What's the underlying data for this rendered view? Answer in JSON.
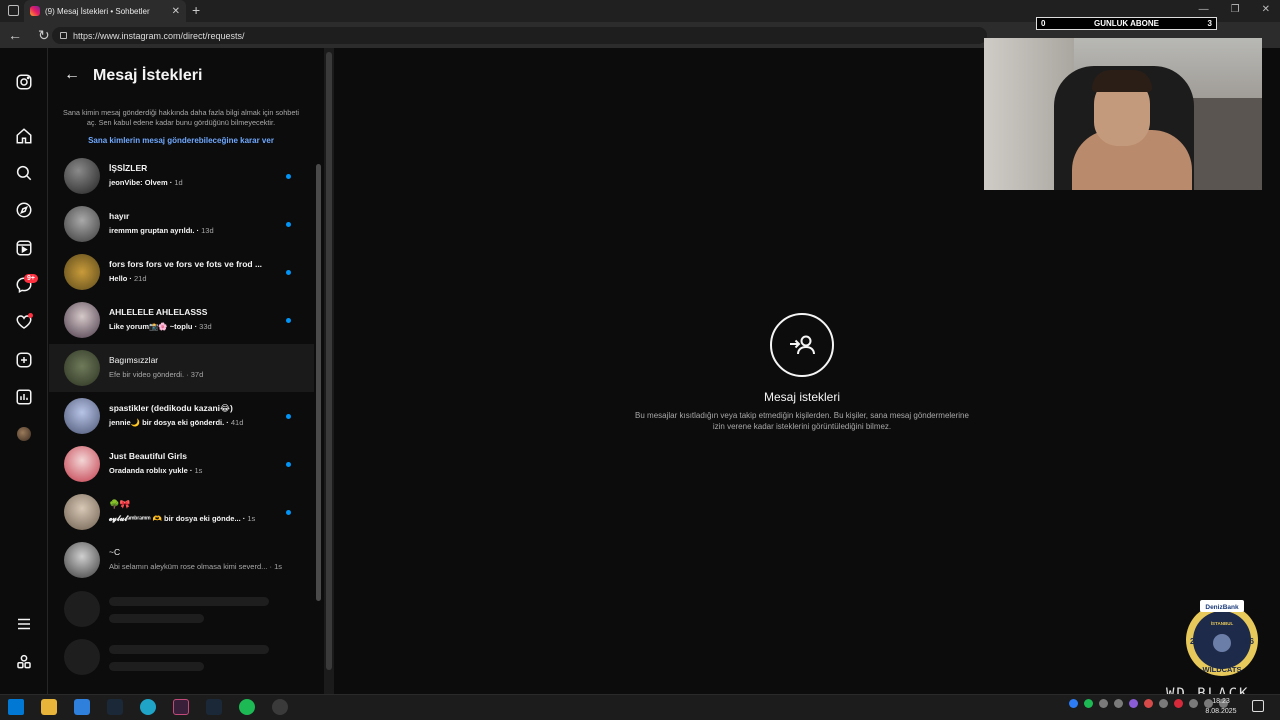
{
  "browser": {
    "tab_title": "(9) Mesaj İstekleri • Sohbetler",
    "tab_close": "✕",
    "new_tab": "+",
    "url": "https://www.instagram.com/direct/requests/",
    "window_controls": [
      "—",
      "❐",
      "✕"
    ]
  },
  "overlay": {
    "left_count": "0",
    "label": "GUNLUK ABONE",
    "right_count": "3"
  },
  "rail": {
    "badge": "9+"
  },
  "panel": {
    "back": "←",
    "title": "Mesaj İstekleri",
    "info": "Sana kimin mesaj gönderdiği hakkında daha fazla bilgi almak için sohbeti aç. Sen kabul edene kadar bunu gördüğünü bilmeyecektir.",
    "link": "Sana kimlerin mesaj gönderebileceğine karar ver",
    "requests": [
      {
        "name": "İŞSİZLER",
        "preview": "jeonVibe: Olvem",
        "time": "1d",
        "unread": true
      },
      {
        "name": "hayır",
        "preview": "iremmm gruptan ayrıldı.",
        "time": "13d",
        "unread": true
      },
      {
        "name": "fors fors fors ve fors ve fots ve frod ...",
        "preview": "Hello",
        "time": "21d",
        "unread": true
      },
      {
        "name": "AHLELELE AHLELASSS",
        "preview": "Like yorum📸🌸 ~toplu",
        "time": "33d",
        "unread": true
      },
      {
        "name": "Bagımsızzlar",
        "preview": "Efe bir video gönderdi.",
        "time": "37d",
        "unread": false
      },
      {
        "name": "spastikler (dedikodu kazani😂)",
        "preview": "jennie🌙 bir dosya eki gönderdi.",
        "time": "41d",
        "unread": true
      },
      {
        "name": "Just Beautiful Girls",
        "preview": "Oradanda roblıx yukle",
        "time": "1s",
        "unread": true
      },
      {
        "name": "🌳🎀",
        "preview": "𝓮𝔂𝓵𝓾𝓵ᵃᵐᵇʳᵃᵐᵐ 🫶 bir dosya eki gönde...",
        "time": "1s",
        "unread": true
      },
      {
        "name": "~C",
        "preview": "Abi selamın aleyküm rose olmasa kimi severd...",
        "time": "1s",
        "unread": false
      }
    ]
  },
  "main": {
    "title": "Mesaj istekleri",
    "description": "Bu mesajlar kısıtladığın veya takip etmediğin kişilerden. Bu kişiler, sana mesaj göndermelerine izin verene kadar isteklerini görüntülediğini bilmez."
  },
  "branding": {
    "logo_top": "DenizBank",
    "logo_city": "İSTANBUL",
    "logo_year_left": "20",
    "logo_year_right": "06",
    "logo_name": "WILDCATS",
    "wd": "WD_BLACK"
  },
  "taskbar": {
    "time": "18:23",
    "date": "8.08.2025"
  },
  "colors": {
    "accent": "#0095f6",
    "background": "#0c0c0c",
    "badge": "#ff3040"
  }
}
